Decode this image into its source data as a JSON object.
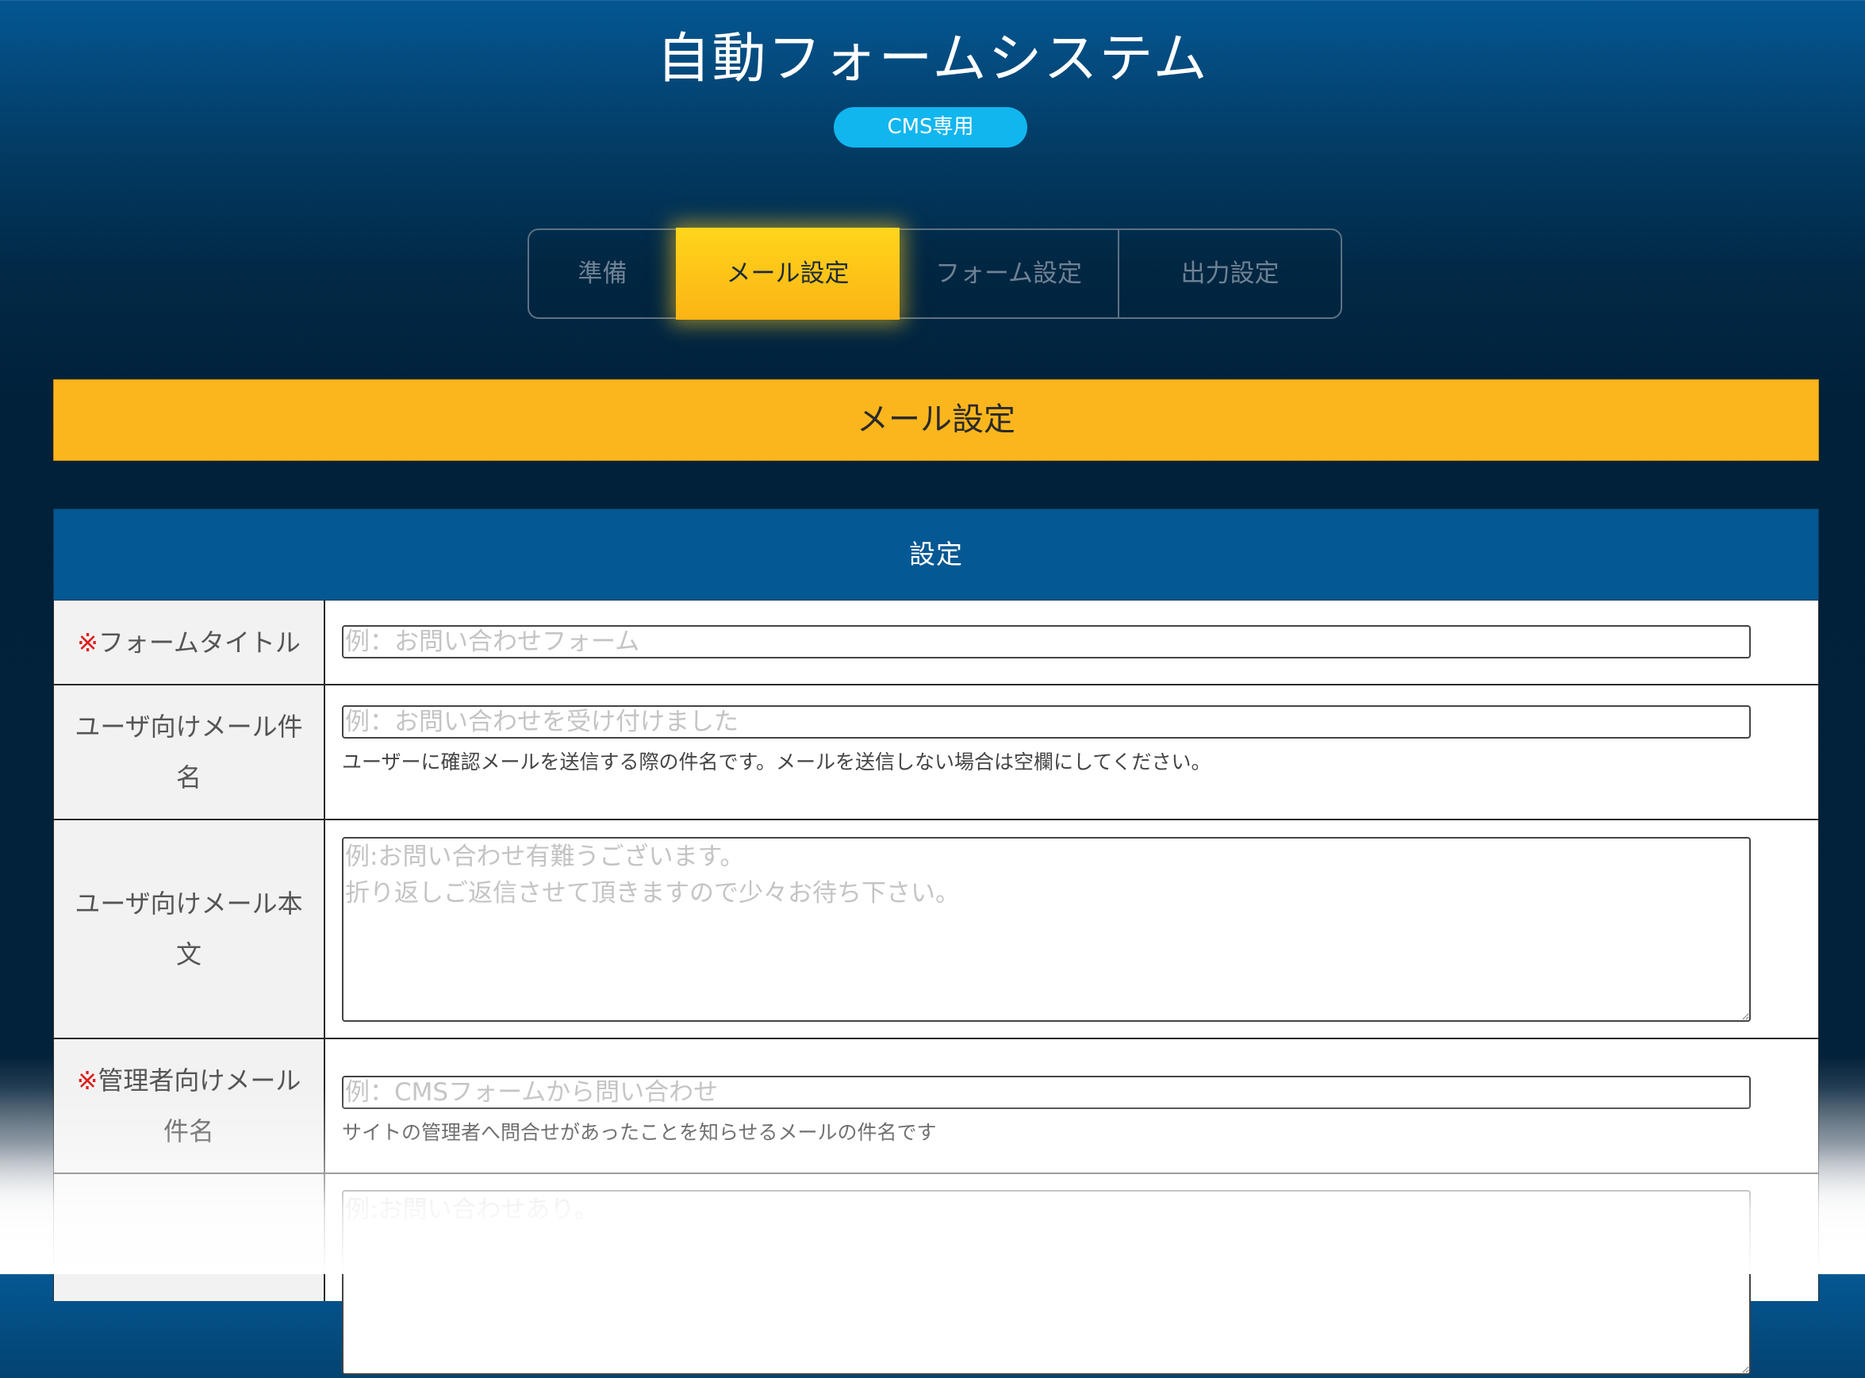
{
  "header": {
    "title": "自動フォームシステム",
    "badge": "CMS専用"
  },
  "tabs": [
    {
      "label": "準備",
      "active": false
    },
    {
      "label": "メール設定",
      "active": true
    },
    {
      "label": "フォーム設定",
      "active": false
    },
    {
      "label": "出力設定",
      "active": false
    }
  ],
  "section": {
    "title": "メール設定"
  },
  "settings": {
    "header": "設定",
    "required_mark": "※",
    "rows": [
      {
        "label": "フォームタイトル",
        "required": true,
        "placeholder": "例：お問い合わせフォーム",
        "help": ""
      },
      {
        "label_line1": "ユーザ向けメール件",
        "label_line2": "名",
        "required": false,
        "placeholder": "例：お問い合わせを受け付けました",
        "help": "ユーザーに確認メールを送信する際の件名です。メールを送信しない場合は空欄にしてください。"
      },
      {
        "label_line1": "ユーザ向けメール本",
        "label_line2": "文",
        "required": false,
        "placeholder": "例:お問い合わせ有難うございます。\n折り返しご返信させて頂きますので少々お待ち下さい。",
        "help": ""
      },
      {
        "label_line1": "管理者向けメール",
        "label_line2": "件名",
        "required": true,
        "placeholder": "例：CMSフォームから問い合わせ",
        "help": "サイトの管理者へ問合せがあったことを知らせるメールの件名です"
      },
      {
        "label": "",
        "required": false,
        "placeholder": "例:お問い合わせあり。",
        "help": ""
      }
    ]
  },
  "colors": {
    "accent": "#fcb61d",
    "header_blue": "#045893",
    "badge": "#11b6ee",
    "required": "#e11c1c"
  }
}
